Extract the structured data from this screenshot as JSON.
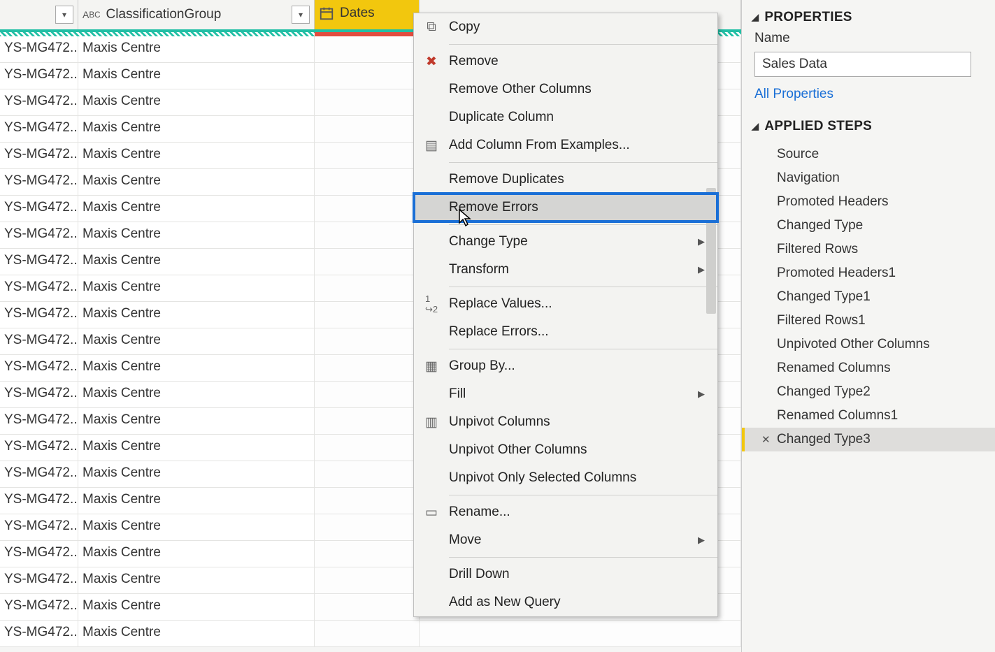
{
  "columns": {
    "col1_label": "ClassificationGroup",
    "col2_label": "Dates"
  },
  "rows": [
    {
      "c0": "YS-MG472...",
      "c1": "Maxis Centre"
    },
    {
      "c0": "YS-MG472...",
      "c1": "Maxis Centre"
    },
    {
      "c0": "YS-MG472...",
      "c1": "Maxis Centre"
    },
    {
      "c0": "YS-MG472...",
      "c1": "Maxis Centre"
    },
    {
      "c0": "YS-MG472...",
      "c1": "Maxis Centre"
    },
    {
      "c0": "YS-MG472...",
      "c1": "Maxis Centre"
    },
    {
      "c0": "YS-MG472...",
      "c1": "Maxis Centre"
    },
    {
      "c0": "YS-MG472...",
      "c1": "Maxis Centre"
    },
    {
      "c0": "YS-MG472...",
      "c1": "Maxis Centre"
    },
    {
      "c0": "YS-MG472...",
      "c1": "Maxis Centre"
    },
    {
      "c0": "YS-MG472...",
      "c1": "Maxis Centre"
    },
    {
      "c0": "YS-MG472...",
      "c1": "Maxis Centre"
    },
    {
      "c0": "YS-MG472...",
      "c1": "Maxis Centre"
    },
    {
      "c0": "YS-MG472...",
      "c1": "Maxis Centre"
    },
    {
      "c0": "YS-MG472...",
      "c1": "Maxis Centre"
    },
    {
      "c0": "YS-MG472...",
      "c1": "Maxis Centre"
    },
    {
      "c0": "YS-MG472...",
      "c1": "Maxis Centre"
    },
    {
      "c0": "YS-MG472...",
      "c1": "Maxis Centre"
    },
    {
      "c0": "YS-MG472...",
      "c1": "Maxis Centre"
    },
    {
      "c0": "YS-MG472...",
      "c1": "Maxis Centre"
    },
    {
      "c0": "YS-MG472...",
      "c1": "Maxis Centre"
    },
    {
      "c0": "YS-MG472...",
      "c1": "Maxis Centre"
    },
    {
      "c0": "YS-MG472...",
      "c1": "Maxis Centre"
    }
  ],
  "context_menu": {
    "copy": "Copy",
    "remove": "Remove",
    "remove_other": "Remove Other Columns",
    "duplicate": "Duplicate Column",
    "add_from_examples": "Add Column From Examples...",
    "remove_duplicates": "Remove Duplicates",
    "remove_errors": "Remove Errors",
    "change_type": "Change Type",
    "transform": "Transform",
    "replace_values": "Replace Values...",
    "replace_errors": "Replace Errors...",
    "group_by": "Group By...",
    "fill": "Fill",
    "unpivot": "Unpivot Columns",
    "unpivot_other": "Unpivot Other Columns",
    "unpivot_selected": "Unpivot Only Selected Columns",
    "rename": "Rename...",
    "move": "Move",
    "drill_down": "Drill Down",
    "add_as_new_query": "Add as New Query"
  },
  "properties": {
    "section_title": "PROPERTIES",
    "name_label": "Name",
    "name_value": "Sales Data",
    "all_props_link": "All Properties"
  },
  "applied_steps": {
    "section_title": "APPLIED STEPS",
    "items": [
      "Source",
      "Navigation",
      "Promoted Headers",
      "Changed Type",
      "Filtered Rows",
      "Promoted Headers1",
      "Changed Type1",
      "Filtered Rows1",
      "Unpivoted Other Columns",
      "Renamed Columns",
      "Changed Type2",
      "Renamed Columns1",
      "Changed Type3"
    ],
    "selected_index": 12
  }
}
